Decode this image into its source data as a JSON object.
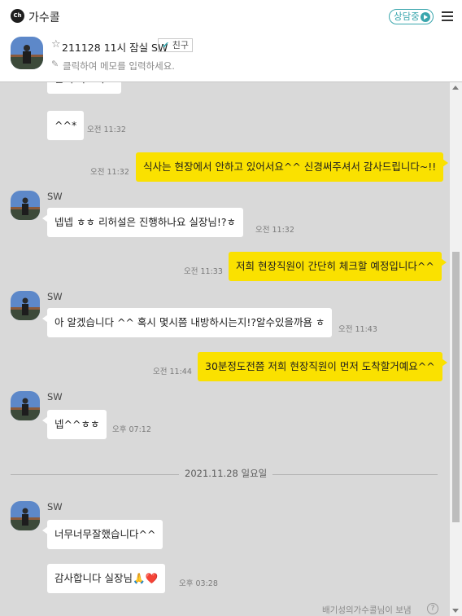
{
  "header": {
    "logo_text": "Ch",
    "title": "가수콜",
    "status": "상담중"
  },
  "profile": {
    "star_icon": "☆",
    "name": "211128 11시 잠실 SW",
    "friend_badge_check": "✔",
    "friend_badge": "친구",
    "pencil_icon": "✎",
    "memo_placeholder": "클릭하여 메모를 입력하세요."
  },
  "chat": {
    "partial_top_message": "잘 부탁드려요",
    "msg1": {
      "text": "^^*",
      "time": "오전 11:32"
    },
    "msg2": {
      "text": "식사는 현장에서 안하고 있어서요^^ 신경써주셔서 감사드립니다~!!",
      "time": "오전 11:32"
    },
    "group1": {
      "sender": "SW",
      "text": "넵넵 ㅎㅎ 리허설은 진행하나요 실장님!?ㅎ",
      "time": "오전 11:32"
    },
    "msg3": {
      "text": "저희 현장직원이 간단히 체크할 예정입니다^^",
      "time": "오전 11:33"
    },
    "group2": {
      "sender": "SW",
      "text": "아 알겠습니다 ^^ 혹시 몇시쯤 내방하시는지!?알수있을까욤 ㅎ",
      "time": "오전 11:43"
    },
    "msg4": {
      "text": "30분정도전쯤 저희 현장직원이 먼저 도착할거예요^^",
      "time": "오전 11:44"
    },
    "group3": {
      "sender": "SW",
      "text": "넵^^ㅎㅎ",
      "time": "오후 07:12"
    },
    "date_divider": "2021.11.28 일요일",
    "group4": {
      "sender": "SW",
      "text": "너무너무잘했습니다^^"
    },
    "msg5": {
      "text": "감사합니다 실장님🙏❤️",
      "time": "오후 03:28"
    },
    "footer_note": "배기성의가수콜님이 보냄",
    "help_icon": "?"
  },
  "colors": {
    "my_bubble": "#fae100",
    "accent": "#3aa6ad",
    "background": "#d9d9d9"
  }
}
